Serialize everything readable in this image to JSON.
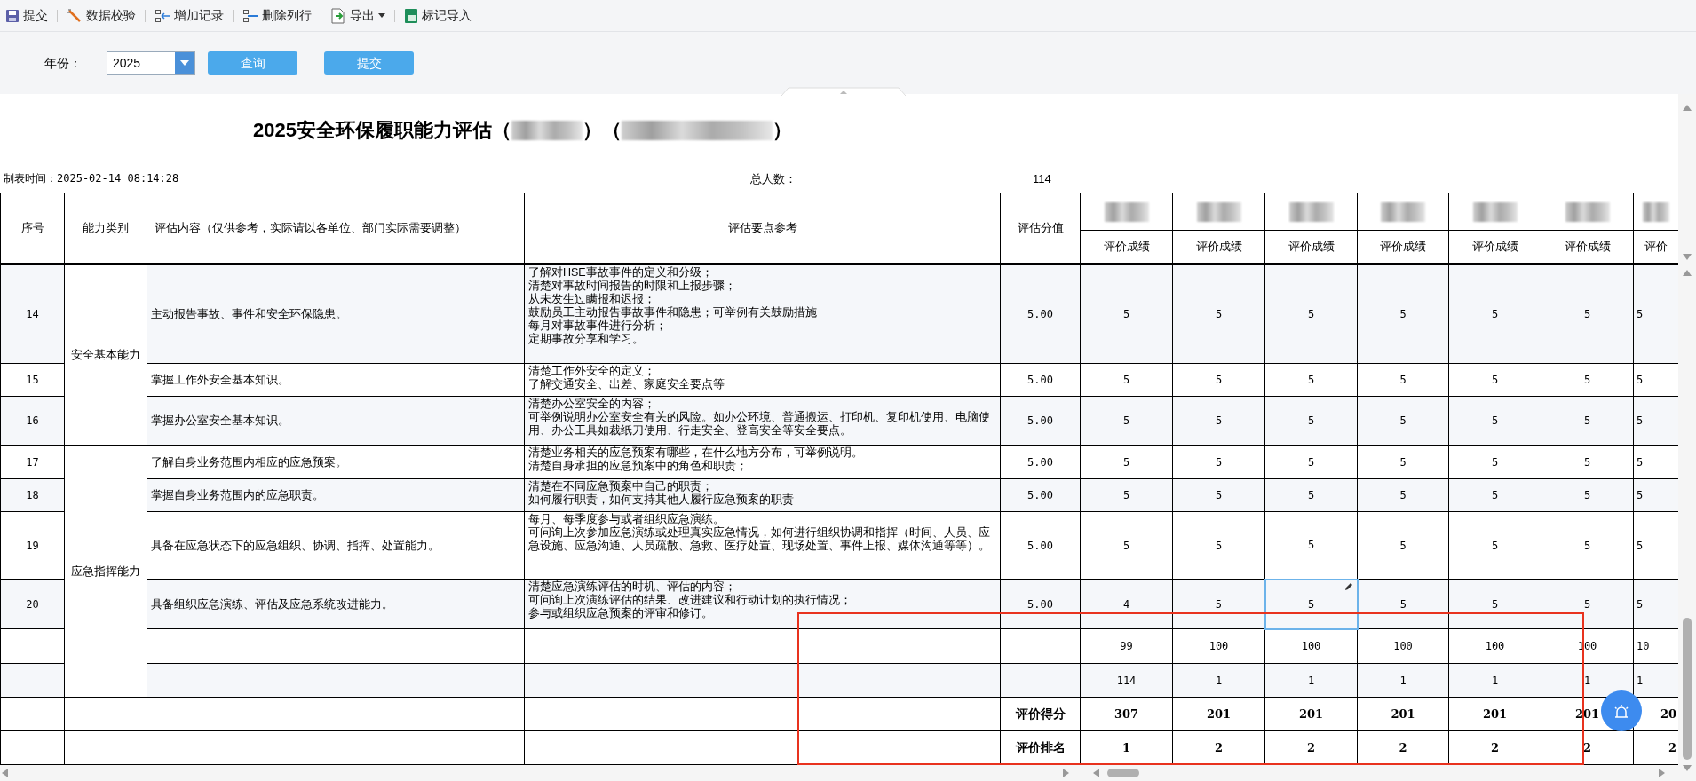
{
  "toolbar": [
    {
      "label": "提交",
      "kind": "save"
    },
    {
      "label": "数据校验",
      "kind": "check"
    },
    {
      "label": "增加记录",
      "kind": "add"
    },
    {
      "label": "删除列行",
      "kind": "delete"
    },
    {
      "label": "导出",
      "kind": "export",
      "caret": true
    },
    {
      "label": "标记导入",
      "kind": "import"
    }
  ],
  "filter": {
    "label": "年份：",
    "year": "2025",
    "buttons": [
      "查询",
      "提交"
    ]
  },
  "title_parts": [
    "2025安全环保履职能力评估（",
    "）（",
    "）"
  ],
  "meta": {
    "time_label": "制表时间：2025-02-14 08:14:28",
    "count_label": "总人数：",
    "count": "114"
  },
  "columns": [
    "序号",
    "能力类别",
    "评估内容（仅供参考，实际请以各单位、部门实际需要调整）",
    "评估要点参考",
    "评估分值"
  ],
  "score_columns": [
    "评价成绩",
    "评价成绩",
    "评价成绩",
    "评价成绩",
    "评价成绩",
    "评价成绩",
    "评价"
  ],
  "groups": [
    {
      "category": "安全基本能力",
      "rows": [
        {
          "no": "14",
          "content": "主动报告事故、事件和安全环保隐患。",
          "points": [
            "了解对HSE事故事件的定义和分级；",
            "清楚对事故时间报告的时限和上报步骤；",
            "从未发生过瞒报和迟报；",
            "鼓励员工主动报告事故事件和隐患；可举例有关鼓励措施",
            "每月对事故事件进行分析；",
            "定期事故分享和学习。"
          ],
          "score": "5.00",
          "values": [
            {
              "v": "5",
              "selected": false
            },
            {
              "v": "5",
              "selected": false
            },
            {
              "v": "5",
              "selected": false
            },
            {
              "v": "5",
              "selected": false
            },
            {
              "v": "5",
              "selected": false
            },
            {
              "v": "5",
              "selected": false
            },
            {
              "v": "5",
              "selected": false
            }
          ]
        },
        {
          "no": "15",
          "content": "掌握工作外安全基本知识。",
          "points": [
            "清楚工作外安全的定义；",
            "了解交通安全、出差、家庭安全要点等"
          ],
          "score": "5.00",
          "values": [
            {
              "v": "5",
              "selected": false
            },
            {
              "v": "5",
              "selected": false
            },
            {
              "v": "5",
              "selected": false
            },
            {
              "v": "5",
              "selected": false
            },
            {
              "v": "5",
              "selected": false
            },
            {
              "v": "5",
              "selected": false
            },
            {
              "v": "5",
              "selected": false
            }
          ]
        },
        {
          "no": "16",
          "content": "掌握办公室安全基本知识。",
          "points": [
            "清楚办公室安全的内容；",
            "可举例说明办公室安全有关的风险。如办公环境、普通搬运、打印机、复印机使用、电脑使用、办公工具如裁纸刀使用、行走安全、登高安全等安全要点。"
          ],
          "score": "5.00",
          "values": [
            {
              "v": "5",
              "selected": false
            },
            {
              "v": "5",
              "selected": false
            },
            {
              "v": "5",
              "selected": false
            },
            {
              "v": "5",
              "selected": false
            },
            {
              "v": "5",
              "selected": false
            },
            {
              "v": "5",
              "selected": false
            },
            {
              "v": "5",
              "selected": false
            }
          ]
        }
      ]
    },
    {
      "category": "应急指挥能力",
      "rows": [
        {
          "no": "17",
          "content": "了解自身业务范围内相应的应急预案。",
          "points": [
            "清楚业务相关的应急预案有哪些，在什么地方分布，可举例说明。",
            "清楚自身承担的应急预案中的角色和职责；"
          ],
          "score": "5.00",
          "values": [
            {
              "v": "5",
              "selected": false
            },
            {
              "v": "5",
              "selected": false
            },
            {
              "v": "5",
              "selected": false
            },
            {
              "v": "5",
              "selected": false
            },
            {
              "v": "5",
              "selected": false
            },
            {
              "v": "5",
              "selected": false
            },
            {
              "v": "5",
              "selected": false
            }
          ]
        },
        {
          "no": "18",
          "content": "掌握自身业务范围内的应急职责。",
          "points": [
            "清楚在不同应急预案中自己的职责；",
            "如何履行职责，如何支持其他人履行应急预案的职责"
          ],
          "score": "5.00",
          "values": [
            {
              "v": "5",
              "selected": false
            },
            {
              "v": "5",
              "selected": false
            },
            {
              "v": "5",
              "selected": false
            },
            {
              "v": "5",
              "selected": false
            },
            {
              "v": "5",
              "selected": false
            },
            {
              "v": "5",
              "selected": false
            },
            {
              "v": "5",
              "selected": false
            }
          ]
        },
        {
          "no": "19",
          "content": "具备在应急状态下的应急组织、协调、指挥、处置能力。",
          "points": [
            "每月、每季度参与或者组织应急演练。",
            "可问询上次参加应急演练或处理真实应急情况，如何进行组织协调和指挥（时间、人员、应急设施、应急沟通、人员疏散、急救、医疗处置、现场处置、事件上报、媒体沟通等等）。"
          ],
          "score": "5.00",
          "values": [
            {
              "v": "5",
              "selected": false
            },
            {
              "v": "5",
              "selected": false
            },
            {
              "v": "5",
              "selected": false
            },
            {
              "v": "5",
              "selected": false
            },
            {
              "v": "5",
              "selected": false
            },
            {
              "v": "5",
              "selected": false
            },
            {
              "v": "5",
              "selected": false
            }
          ]
        },
        {
          "no": "20",
          "content": "具备组织应急演练、评估及应急系统改进能力。",
          "points": [
            "清楚应急演练评估的时机、评估的内容；",
            "可问询上次演练评估的结果、改进建议和行动计划的执行情况；",
            "参与或组织应急预案的评审和修订。"
          ],
          "score": "5.00",
          "values": [
            {
              "v": "4",
              "selected": false
            },
            {
              "v": "5",
              "selected": false
            },
            {
              "v": "5",
              "selected": true
            },
            {
              "v": "5",
              "selected": false
            },
            {
              "v": "5",
              "selected": false
            },
            {
              "v": "5",
              "selected": false
            },
            {
              "v": "5",
              "selected": false
            }
          ]
        },
        {
          "values": [
            {
              "v": "99",
              "selected": false
            },
            {
              "v": "100",
              "selected": false
            },
            {
              "v": "100",
              "selected": false
            },
            {
              "v": "100",
              "selected": false
            },
            {
              "v": "100",
              "selected": false
            },
            {
              "v": "100",
              "selected": false
            },
            {
              "v": "10",
              "selected": false
            }
          ]
        },
        {
          "values": [
            {
              "v": "114",
              "selected": false
            },
            {
              "v": "1",
              "selected": false
            },
            {
              "v": "1",
              "selected": false
            },
            {
              "v": "1",
              "selected": false
            },
            {
              "v": "1",
              "selected": false
            },
            {
              "v": "1",
              "selected": false
            },
            {
              "v": "1",
              "selected": false
            }
          ]
        }
      ]
    }
  ],
  "summary_rows": [
    {
      "label": "评价得分",
      "values": [
        "307",
        "201",
        "201",
        "201",
        "201",
        "201",
        "20"
      ]
    },
    {
      "label": "评价排名",
      "values": [
        "1",
        "2",
        "2",
        "2",
        "2",
        "2",
        "2"
      ]
    }
  ]
}
